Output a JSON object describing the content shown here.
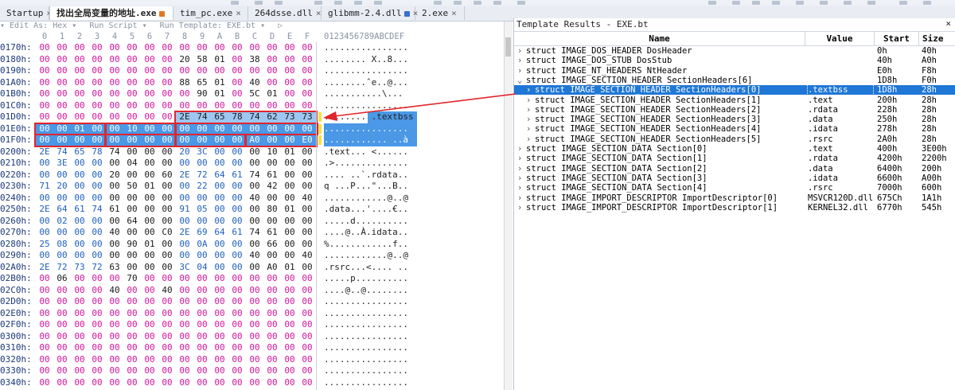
{
  "tabs": [
    {
      "label": "Startup",
      "close": "×",
      "active": false
    },
    {
      "label": "找出全局变量的地址.exe",
      "active": true,
      "modified": true
    },
    {
      "label": "tim_pc.exe",
      "close": "×",
      "active": false
    },
    {
      "label": "264dsse.dll",
      "close": "×",
      "active": false
    },
    {
      "label": "glibmm-2.4.dll",
      "close": "×",
      "active": false,
      "locked": true
    },
    {
      "label": "2.exe",
      "close": "×",
      "active": false
    }
  ],
  "editor_toolbar": {
    "edit_as": "▾ Edit As: Hex ▾",
    "run_script": "Run Script ▾",
    "run_template": "Run Template: EXE.bt ▾",
    "nav": "▷"
  },
  "hex": {
    "columns": [
      "0",
      "1",
      "2",
      "3",
      "4",
      "5",
      "6",
      "7",
      "8",
      "9",
      "A",
      "B",
      "C",
      "D",
      "E",
      "F"
    ],
    "ascii_header": "0123456789ABCDEF",
    "rows": [
      {
        "addr": "0170h:",
        "bytes": [
          "00",
          "00",
          "00",
          "00",
          "00",
          "00",
          "00",
          "00",
          "00",
          "00",
          "00",
          "00",
          "00",
          "00",
          "00",
          "00"
        ],
        "ascii": "................"
      },
      {
        "addr": "0180h:",
        "bytes": [
          "00",
          "00",
          "00",
          "00",
          "00",
          "00",
          "00",
          "00",
          "20",
          "58",
          "01",
          "00",
          "38",
          "00",
          "00",
          "00"
        ],
        "ascii": "........ X..8..."
      },
      {
        "addr": "0190h:",
        "bytes": [
          "00",
          "00",
          "00",
          "00",
          "00",
          "00",
          "00",
          "00",
          "00",
          "00",
          "00",
          "00",
          "00",
          "00",
          "00",
          "00"
        ],
        "ascii": "................"
      },
      {
        "addr": "01A0h:",
        "bytes": [
          "00",
          "00",
          "00",
          "00",
          "00",
          "00",
          "00",
          "00",
          "88",
          "65",
          "01",
          "00",
          "40",
          "00",
          "00",
          "00"
        ],
        "ascii": "........ˆe..@..."
      },
      {
        "addr": "01B0h:",
        "bytes": [
          "00",
          "00",
          "00",
          "00",
          "00",
          "00",
          "00",
          "00",
          "00",
          "90",
          "01",
          "00",
          "5C",
          "01",
          "00",
          "00"
        ],
        "ascii": "...........\\..."
      },
      {
        "addr": "01C0h:",
        "bytes": [
          "00",
          "00",
          "00",
          "00",
          "00",
          "00",
          "00",
          "00",
          "00",
          "00",
          "00",
          "00",
          "00",
          "00",
          "00",
          "00"
        ],
        "ascii": "................"
      },
      {
        "addr": "01D0h:",
        "bytes": [
          "00",
          "00",
          "00",
          "00",
          "00",
          "00",
          "00",
          "00",
          "2E",
          "74",
          "65",
          "78",
          "74",
          "62",
          "73",
          "73"
        ],
        "ascii": "........ .textbss"
      },
      {
        "addr": "01E0h:",
        "bytes": [
          "00",
          "00",
          "01",
          "00",
          "00",
          "10",
          "00",
          "00",
          "00",
          "00",
          "00",
          "00",
          "00",
          "00",
          "00",
          "00"
        ],
        "ascii": "................"
      },
      {
        "addr": "01F0h:",
        "bytes": [
          "00",
          "00",
          "00",
          "00",
          "00",
          "00",
          "00",
          "00",
          "00",
          "00",
          "00",
          "00",
          "A0",
          "00",
          "00",
          "E0"
        ],
        "ascii": "............ ..à"
      },
      {
        "addr": "0200h:",
        "bytes": [
          "2E",
          "74",
          "65",
          "78",
          "74",
          "00",
          "00",
          "00",
          "20",
          "3C",
          "00",
          "00",
          "00",
          "10",
          "01",
          "00"
        ],
        "ascii": ".text... <......"
      },
      {
        "addr": "0210h:",
        "bytes": [
          "00",
          "3E",
          "00",
          "00",
          "00",
          "04",
          "00",
          "00",
          "00",
          "00",
          "00",
          "00",
          "00",
          "00",
          "00",
          "00"
        ],
        "ascii": ".>.............."
      },
      {
        "addr": "0220h:",
        "bytes": [
          "00",
          "00",
          "00",
          "00",
          "20",
          "00",
          "00",
          "60",
          "2E",
          "72",
          "64",
          "61",
          "74",
          "61",
          "00",
          "00"
        ],
        "ascii": ".... ..`.rdata.."
      },
      {
        "addr": "0230h:",
        "bytes": [
          "71",
          "20",
          "00",
          "00",
          "00",
          "50",
          "01",
          "00",
          "00",
          "22",
          "00",
          "00",
          "00",
          "42",
          "00",
          "00"
        ],
        "ascii": "q ...P...\"...B.."
      },
      {
        "addr": "0240h:",
        "bytes": [
          "00",
          "00",
          "00",
          "00",
          "00",
          "00",
          "00",
          "00",
          "00",
          "00",
          "00",
          "00",
          "40",
          "00",
          "00",
          "40"
        ],
        "ascii": "............@..@"
      },
      {
        "addr": "0250h:",
        "bytes": [
          "2E",
          "64",
          "61",
          "74",
          "61",
          "00",
          "00",
          "00",
          "91",
          "05",
          "00",
          "00",
          "00",
          "80",
          "01",
          "00"
        ],
        "ascii": ".data...'....€.."
      },
      {
        "addr": "0260h:",
        "bytes": [
          "00",
          "02",
          "00",
          "00",
          "00",
          "64",
          "00",
          "00",
          "00",
          "00",
          "00",
          "00",
          "00",
          "00",
          "00",
          "00"
        ],
        "ascii": ".....d.........."
      },
      {
        "addr": "0270h:",
        "bytes": [
          "00",
          "00",
          "00",
          "00",
          "40",
          "00",
          "00",
          "C0",
          "2E",
          "69",
          "64",
          "61",
          "74",
          "61",
          "00",
          "00"
        ],
        "ascii": "....@..À.idata.."
      },
      {
        "addr": "0280h:",
        "bytes": [
          "25",
          "08",
          "00",
          "00",
          "00",
          "90",
          "01",
          "00",
          "00",
          "0A",
          "00",
          "00",
          "00",
          "66",
          "00",
          "00"
        ],
        "ascii": "%............f.."
      },
      {
        "addr": "0290h:",
        "bytes": [
          "00",
          "00",
          "00",
          "00",
          "00",
          "00",
          "00",
          "00",
          "00",
          "00",
          "00",
          "00",
          "40",
          "00",
          "00",
          "40"
        ],
        "ascii": "............@..@"
      },
      {
        "addr": "02A0h:",
        "bytes": [
          "2E",
          "72",
          "73",
          "72",
          "63",
          "00",
          "00",
          "00",
          "3C",
          "04",
          "00",
          "00",
          "00",
          "A0",
          "01",
          "00"
        ],
        "ascii": ".rsrc...<.... .."
      },
      {
        "addr": "02B0h:",
        "bytes": [
          "00",
          "06",
          "00",
          "00",
          "00",
          "70",
          "00",
          "00",
          "00",
          "00",
          "00",
          "00",
          "00",
          "00",
          "00",
          "00"
        ],
        "ascii": ".....p.........."
      },
      {
        "addr": "02C0h:",
        "bytes": [
          "00",
          "00",
          "00",
          "00",
          "40",
          "00",
          "00",
          "40",
          "00",
          "00",
          "00",
          "00",
          "00",
          "00",
          "00",
          "00"
        ],
        "ascii": "....@..@........"
      },
      {
        "addr": "02D0h:",
        "bytes": [
          "00",
          "00",
          "00",
          "00",
          "00",
          "00",
          "00",
          "00",
          "00",
          "00",
          "00",
          "00",
          "00",
          "00",
          "00",
          "00"
        ],
        "ascii": "................"
      },
      {
        "addr": "02E0h:",
        "bytes": [
          "00",
          "00",
          "00",
          "00",
          "00",
          "00",
          "00",
          "00",
          "00",
          "00",
          "00",
          "00",
          "00",
          "00",
          "00",
          "00"
        ],
        "ascii": "................"
      },
      {
        "addr": "02F0h:",
        "bytes": [
          "00",
          "00",
          "00",
          "00",
          "00",
          "00",
          "00",
          "00",
          "00",
          "00",
          "00",
          "00",
          "00",
          "00",
          "00",
          "00"
        ],
        "ascii": "................"
      },
      {
        "addr": "0300h:",
        "bytes": [
          "00",
          "00",
          "00",
          "00",
          "00",
          "00",
          "00",
          "00",
          "00",
          "00",
          "00",
          "00",
          "00",
          "00",
          "00",
          "00"
        ],
        "ascii": "................"
      },
      {
        "addr": "0310h:",
        "bytes": [
          "00",
          "00",
          "00",
          "00",
          "00",
          "00",
          "00",
          "00",
          "00",
          "00",
          "00",
          "00",
          "00",
          "00",
          "00",
          "00"
        ],
        "ascii": "................"
      },
      {
        "addr": "0320h:",
        "bytes": [
          "00",
          "00",
          "00",
          "00",
          "00",
          "00",
          "00",
          "00",
          "00",
          "00",
          "00",
          "00",
          "00",
          "00",
          "00",
          "00"
        ],
        "ascii": "................"
      },
      {
        "addr": "0330h:",
        "bytes": [
          "00",
          "00",
          "00",
          "00",
          "00",
          "00",
          "00",
          "00",
          "00",
          "00",
          "00",
          "00",
          "00",
          "00",
          "00",
          "00"
        ],
        "ascii": "................"
      },
      {
        "addr": "0340h:",
        "bytes": [
          "00",
          "00",
          "00",
          "00",
          "00",
          "00",
          "00",
          "00",
          "00",
          "00",
          "00",
          "00",
          "00",
          "00",
          "00",
          "00"
        ],
        "ascii": "................"
      }
    ]
  },
  "colors": {
    "pink": "#d4179c",
    "blue": "#1f5fbf",
    "black": "#1a1a1a",
    "selection": "#4a98e6",
    "highlight": "#e0262c"
  },
  "template_panel": {
    "title": "Template Results - EXE.bt",
    "close": "×",
    "headers": {
      "name": "Name",
      "value": "Value",
      "start": "Start",
      "size": "Size"
    },
    "rows": [
      {
        "indent": 0,
        "expanded": false,
        "name": "struct IMAGE_DOS_HEADER DosHeader",
        "value": "",
        "start": "0h",
        "size": "40h"
      },
      {
        "indent": 0,
        "expanded": false,
        "name": "struct IMAGE_DOS_STUB DosStub",
        "value": "",
        "start": "40h",
        "size": "A0h"
      },
      {
        "indent": 0,
        "expanded": false,
        "name": "struct IMAGE_NT_HEADERS NtHeader",
        "value": "",
        "start": "E0h",
        "size": "F8h"
      },
      {
        "indent": 0,
        "expanded": true,
        "name": "struct IMAGE_SECTION_HEADER SectionHeaders[6]",
        "value": "",
        "start": "1D8h",
        "size": "F0h"
      },
      {
        "indent": 1,
        "expanded": false,
        "selected": true,
        "name": "struct IMAGE_SECTION_HEADER SectionHeaders[0]",
        "value": ".textbss",
        "start": "1D8h",
        "size": "28h"
      },
      {
        "indent": 1,
        "expanded": false,
        "name": "struct IMAGE_SECTION_HEADER SectionHeaders[1]",
        "value": ".text",
        "start": "200h",
        "size": "28h"
      },
      {
        "indent": 1,
        "expanded": false,
        "name": "struct IMAGE_SECTION_HEADER SectionHeaders[2]",
        "value": ".rdata",
        "start": "228h",
        "size": "28h"
      },
      {
        "indent": 1,
        "expanded": false,
        "name": "struct IMAGE_SECTION_HEADER SectionHeaders[3]",
        "value": ".data",
        "start": "250h",
        "size": "28h"
      },
      {
        "indent": 1,
        "expanded": false,
        "name": "struct IMAGE_SECTION_HEADER SectionHeaders[4]",
        "value": ".idata",
        "start": "278h",
        "size": "28h"
      },
      {
        "indent": 1,
        "expanded": false,
        "name": "struct IMAGE_SECTION_HEADER SectionHeaders[5]",
        "value": ".rsrc",
        "start": "2A0h",
        "size": "28h"
      },
      {
        "indent": 0,
        "expanded": false,
        "name": "struct IMAGE_SECTION_DATA Section[0]",
        "value": ".text",
        "start": "400h",
        "size": "3E00h"
      },
      {
        "indent": 0,
        "expanded": false,
        "name": "struct IMAGE_SECTION_DATA Section[1]",
        "value": ".rdata",
        "start": "4200h",
        "size": "2200h"
      },
      {
        "indent": 0,
        "expanded": false,
        "name": "struct IMAGE_SECTION_DATA Section[2]",
        "value": ".data",
        "start": "6400h",
        "size": "200h"
      },
      {
        "indent": 0,
        "expanded": false,
        "name": "struct IMAGE_SECTION_DATA Section[3]",
        "value": ".idata",
        "start": "6600h",
        "size": "A00h"
      },
      {
        "indent": 0,
        "expanded": false,
        "name": "struct IMAGE_SECTION_DATA Section[4]",
        "value": ".rsrc",
        "start": "7000h",
        "size": "600h"
      },
      {
        "indent": 0,
        "expanded": false,
        "name": "struct IMAGE_IMPORT_DESCRIPTOR ImportDescriptor[0]",
        "value": "MSVCR120D.dll",
        "start": "675Ch",
        "size": "1A1h"
      },
      {
        "indent": 0,
        "expanded": false,
        "name": "struct IMAGE_IMPORT_DESCRIPTOR ImportDescriptor[1]",
        "value": "KERNEL32.dll",
        "start": "6770h",
        "size": "545h"
      }
    ]
  }
}
